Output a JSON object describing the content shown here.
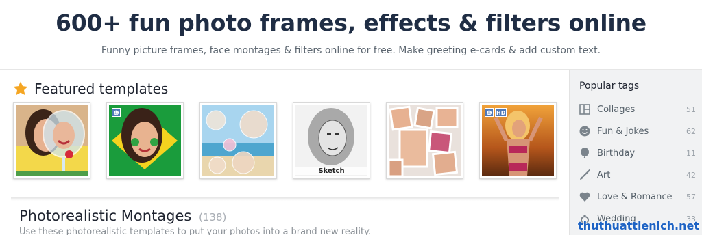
{
  "hero": {
    "title": "600+ fun photo frames, effects & filters online",
    "subtitle": "Funny picture frames, face montages & filters online for free. Make greeting e-cards & add custom text."
  },
  "featured": {
    "title": "Featured templates",
    "icon": "star-icon",
    "templates": [
      {
        "name": "wine-glass-montage",
        "badges": []
      },
      {
        "name": "brazil-flag-face-paint",
        "badges": [
          "user-icon"
        ]
      },
      {
        "name": "beach-bubbles",
        "badges": []
      },
      {
        "name": "pencil-sketch",
        "badges": [],
        "label": "Sketch"
      },
      {
        "name": "photo-collage",
        "badges": []
      },
      {
        "name": "golden-sunset",
        "badges": [
          "user-icon",
          "HD"
        ]
      }
    ]
  },
  "section": {
    "title": "Photorealistic Montages",
    "count": "(138)",
    "description": "Use these photorealistic templates to put your photos into a brand new reality."
  },
  "sidebar": {
    "title": "Popular tags",
    "tags": [
      {
        "label": "Collages",
        "count": "51",
        "icon": "collage-icon"
      },
      {
        "label": "Fun & Jokes",
        "count": "62",
        "icon": "smiley-icon"
      },
      {
        "label": "Birthday",
        "count": "11",
        "icon": "balloon-icon"
      },
      {
        "label": "Art",
        "count": "42",
        "icon": "brush-icon"
      },
      {
        "label": "Love & Romance",
        "count": "57",
        "icon": "heart-icon"
      },
      {
        "label": "Wedding",
        "count": "33",
        "icon": "ring-icon"
      }
    ]
  },
  "watermark": "thuthuattienich.net",
  "colors": {
    "accent_star": "#f5a623",
    "title": "#1f2d44",
    "icon_gray": "#7b848c",
    "badge_blue": "#4f79b8"
  }
}
